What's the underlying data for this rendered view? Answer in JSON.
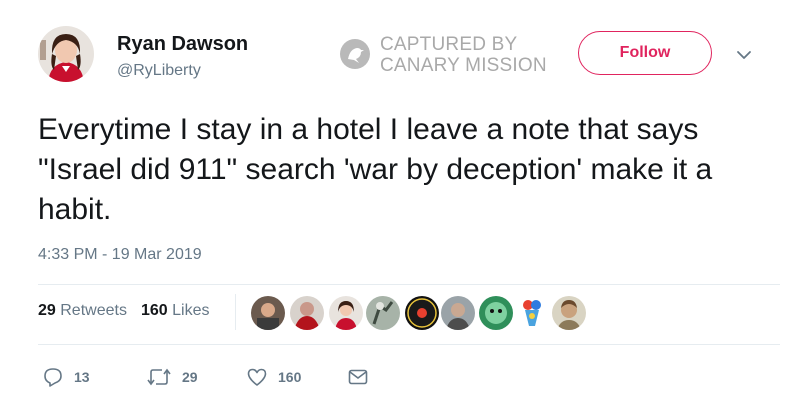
{
  "user": {
    "display_name": "Ryan Dawson",
    "handle": "@RyLiberty"
  },
  "watermark": {
    "line1": "CAPTURED BY",
    "line2": "CANARY MISSION"
  },
  "follow_label": "Follow",
  "tweet": {
    "text": "Everytime I stay in a hotel I leave a note that says \"Israel did 911\" search 'war by deception' make it a habit.",
    "timestamp": "4:33 PM - 19 Mar 2019"
  },
  "stats": {
    "retweets_count": "29",
    "retweets_label": "Retweets",
    "likes_count": "160",
    "likes_label": "Likes"
  },
  "actions": {
    "reply_count": "13",
    "retweet_count": "29",
    "like_count": "160"
  },
  "colors": {
    "accent": "#e0245e",
    "secondary_text": "#657786",
    "primary_text": "#14171a"
  },
  "likers": [
    "liker-avatar",
    "liker-avatar",
    "liker-avatar",
    "liker-avatar",
    "liker-avatar",
    "liker-avatar",
    "liker-avatar",
    "liker-avatar",
    "liker-avatar"
  ]
}
